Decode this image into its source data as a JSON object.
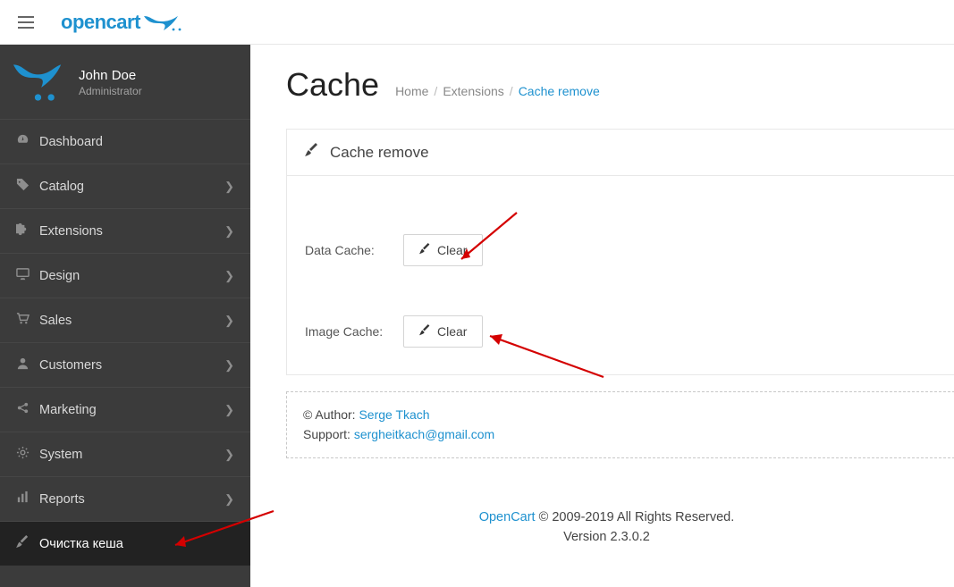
{
  "brand": {
    "name": "opencart"
  },
  "user": {
    "name": "John Doe",
    "role": "Administrator"
  },
  "menu": [
    {
      "icon": "dashboard",
      "label": "Dashboard",
      "expand": false
    },
    {
      "icon": "tag",
      "label": "Catalog",
      "expand": true
    },
    {
      "icon": "puzzle",
      "label": "Extensions",
      "expand": true
    },
    {
      "icon": "desktop",
      "label": " Design",
      "expand": true
    },
    {
      "icon": "cart",
      "label": "Sales",
      "expand": true
    },
    {
      "icon": "user",
      "label": "Customers",
      "expand": true
    },
    {
      "icon": "share",
      "label": "Marketing",
      "expand": true
    },
    {
      "icon": "cog",
      "label": "System",
      "expand": true
    },
    {
      "icon": "bars",
      "label": "Reports",
      "expand": true
    },
    {
      "icon": "brush",
      "label": "Очистка кеша",
      "expand": false,
      "active": true
    }
  ],
  "page": {
    "title": "Cache"
  },
  "breadcrumbs": [
    {
      "label": "Home",
      "link": false
    },
    {
      "label": "Extensions",
      "link": false
    },
    {
      "label": "Cache remove",
      "link": true
    }
  ],
  "panel": {
    "title": "Cache remove",
    "rows": [
      {
        "label": "Data Cache:",
        "button": "Clear"
      },
      {
        "label": "Image Cache:",
        "button": "Clear"
      }
    ]
  },
  "info": {
    "author_prefix": "© Author: ",
    "author_name": "Serge Tkach",
    "support_prefix": "Support: ",
    "support_email": "sergheitkach@gmail.com"
  },
  "footer": {
    "link": "OpenCart",
    "rights": " © 2009-2019 All Rights Reserved.",
    "version": "Version 2.3.0.2"
  }
}
